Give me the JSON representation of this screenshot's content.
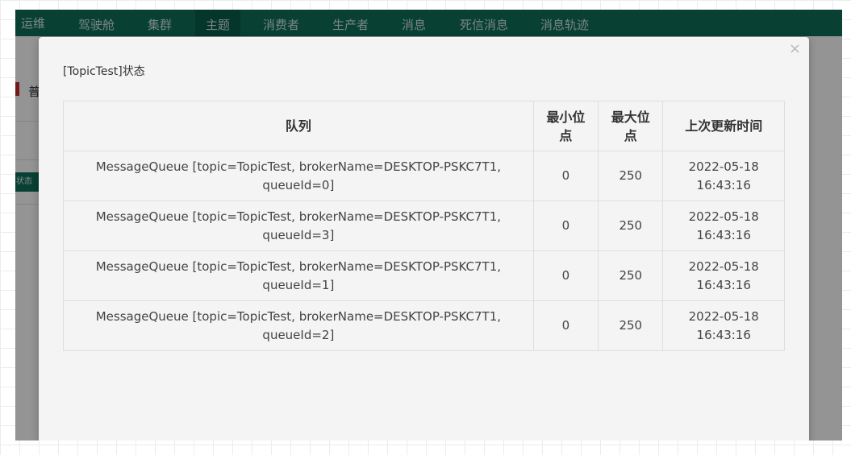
{
  "navbar": {
    "brand": "运维",
    "items": [
      {
        "label": "驾驶舱"
      },
      {
        "label": "集群"
      },
      {
        "label": "主题"
      },
      {
        "label": "消费者"
      },
      {
        "label": "生产者"
      },
      {
        "label": "消息"
      },
      {
        "label": "死信消息"
      },
      {
        "label": "消息轨迹"
      }
    ],
    "active_index": 2
  },
  "page": {
    "tab_text": "普",
    "status_button": "状态"
  },
  "modal": {
    "close_glyph": "×",
    "title": "[TopicTest]状态",
    "table": {
      "headers": [
        "队列",
        "最小位点",
        "最大位点",
        "上次更新时间"
      ],
      "rows": [
        {
          "queue": "MessageQueue [topic=TopicTest, brokerName=DESKTOP-PSKC7T1, queueId=0]",
          "min": "0",
          "max": "250",
          "updated": "2022-05-18 16:43:16"
        },
        {
          "queue": "MessageQueue [topic=TopicTest, brokerName=DESKTOP-PSKC7T1, queueId=3]",
          "min": "0",
          "max": "250",
          "updated": "2022-05-18 16:43:16"
        },
        {
          "queue": "MessageQueue [topic=TopicTest, brokerName=DESKTOP-PSKC7T1, queueId=1]",
          "min": "0",
          "max": "250",
          "updated": "2022-05-18 16:43:16"
        },
        {
          "queue": "MessageQueue [topic=TopicTest, brokerName=DESKTOP-PSKC7T1, queueId=2]",
          "min": "0",
          "max": "250",
          "updated": "2022-05-18 16:43:16"
        }
      ]
    }
  },
  "colors": {
    "navbar": "#0e6f58",
    "accent_red": "#c9302c"
  }
}
